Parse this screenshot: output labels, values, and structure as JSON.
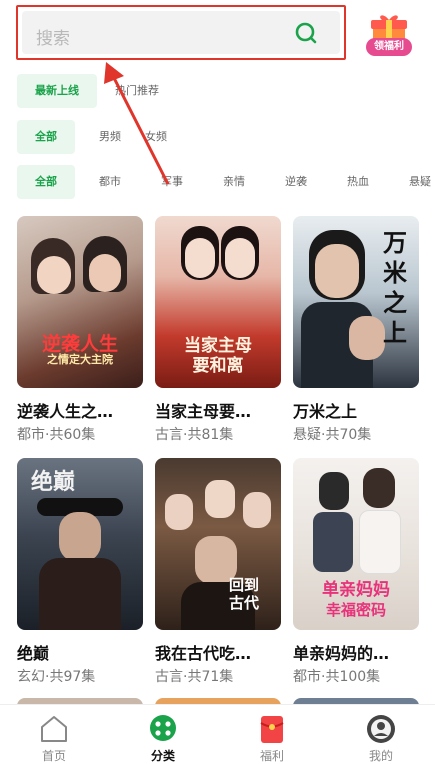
{
  "search": {
    "placeholder": "搜索"
  },
  "promo": {
    "label": "领福利"
  },
  "tabs_sort": [
    {
      "label": "最新上线",
      "active": true
    },
    {
      "label": "热门推荐",
      "active": false
    }
  ],
  "gender": [
    {
      "label": "全部",
      "active": true
    },
    {
      "label": "男频",
      "active": false
    },
    {
      "label": "女频",
      "active": false
    }
  ],
  "genres": [
    {
      "label": "全部",
      "active": true
    },
    {
      "label": "都市"
    },
    {
      "label": "军事"
    },
    {
      "label": "亲情"
    },
    {
      "label": "逆袭"
    },
    {
      "label": "热血"
    },
    {
      "label": "悬疑"
    }
  ],
  "cards": [
    {
      "title": "逆袭人生之…",
      "meta": "都市·共60集",
      "poster_text": "逆袭人生",
      "poster_sub": "之情定大主院"
    },
    {
      "title": "当家主母要…",
      "meta": "古言·共81集",
      "poster_text": "当家主母",
      "poster_sub": "要和离"
    },
    {
      "title": "万米之上",
      "meta": "悬疑·共70集",
      "poster_text": "万米之上",
      "poster_sub": ""
    },
    {
      "title": "绝巅",
      "meta": "玄幻·共97集",
      "poster_text": "绝巅",
      "poster_sub": ""
    },
    {
      "title": "我在古代吃…",
      "meta": "古言·共71集",
      "poster_text": "回到古代",
      "poster_sub": ""
    },
    {
      "title": "单亲妈妈的…",
      "meta": "都市·共100集",
      "poster_text": "单亲妈妈",
      "poster_sub": "幸福密码"
    }
  ],
  "tabbar": {
    "home": "首页",
    "category": "分类",
    "welfare": "福利",
    "mine": "我的"
  },
  "colors": {
    "accent": "#1aa34a",
    "highlight": "#e0352b"
  }
}
